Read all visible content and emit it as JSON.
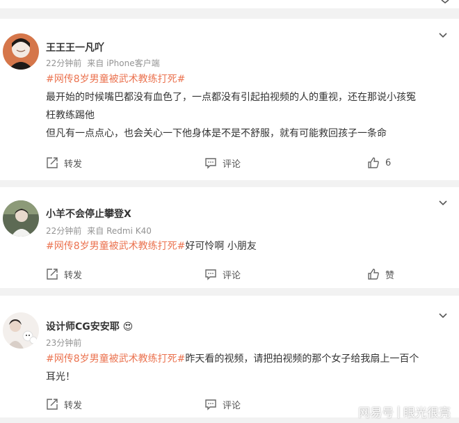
{
  "comments": [
    {
      "username": "王王王一凡吖",
      "time": "22分钟前",
      "source": "来自 iPhone客户端",
      "hashtag": "#网传8岁男童被武术教练打死#",
      "body_lines": [
        "最开始的时候嘴巴都没有血色了，一点都没有引起拍视频的人的重视，还在那说小孩冤",
        "枉教练踢他",
        "但凡有一点点心，也会关心一下他身体是不是不舒服，就有可能救回孩子一条命"
      ],
      "repost_label": "转发",
      "comment_label": "评论",
      "like_label": "6"
    },
    {
      "username": "小羊不会停止攀登X",
      "time": "22分钟前",
      "source": "来自 Redmi K40",
      "hashtag": "#网传8岁男童被武术教练打死#",
      "body_after_tag": "好可怜啊 小朋友",
      "repost_label": "转发",
      "comment_label": "评论",
      "like_label": "赞"
    },
    {
      "username": "设计师CG安安耶",
      "badge_emoji": "😍",
      "time": "23分钟前",
      "hashtag": "#网传8岁男童被武术教练打死#",
      "body_after_tag": "昨天看的视频，请把拍视频的那个女子给我扇上一百个",
      "body_line2": "耳光！",
      "repost_label": "转发",
      "comment_label": "评论"
    }
  ],
  "watermark": {
    "left": "网易号",
    "right": "眼光很亮"
  },
  "colors": {
    "hashtag": "#eb7350",
    "background": "#f2f2f2",
    "meta": "#939393"
  }
}
